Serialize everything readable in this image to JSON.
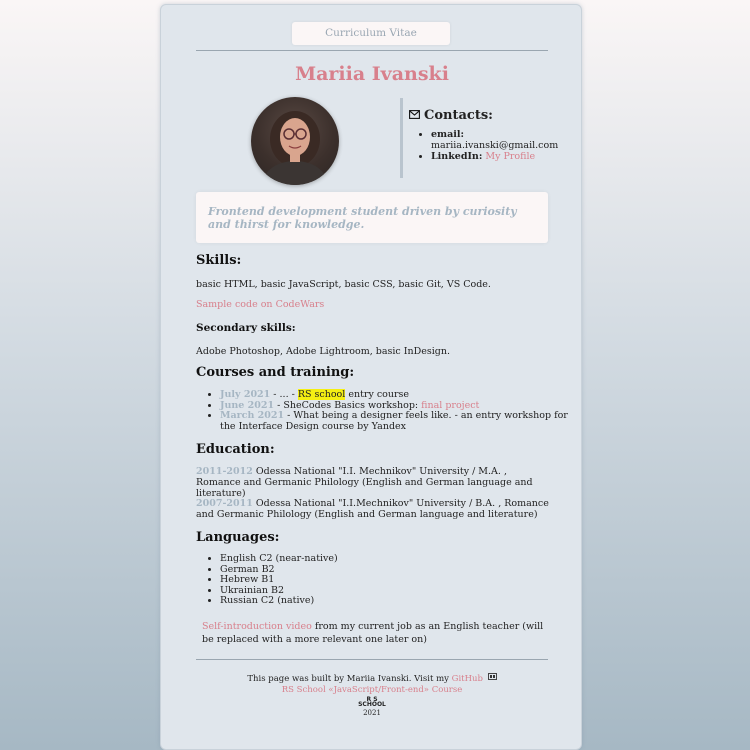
{
  "header": {
    "tag": "Curriculum Vitae",
    "name": "Mariia Ivanski"
  },
  "avatar": {
    "alt": "profile photo"
  },
  "contacts": {
    "title": "Contacts:",
    "email_label": "email:",
    "email_value": "mariia.ivanski@gmail.com",
    "linkedin_label": "LinkedIn:",
    "linkedin_link": "My Profile"
  },
  "about": {
    "text": "Frontend development student driven by curiosity and thirst for knowledge."
  },
  "skills": {
    "title": "Skills:",
    "text": "basic HTML, basic JavaScript, basic CSS, basic Git, VS Code.",
    "sample_link": "Sample code on CodeWars",
    "secondary_title": "Secondary skills:",
    "secondary_text": "Adobe Photoshop, Adobe Lightroom, basic InDesign."
  },
  "courses": {
    "title": "Courses and training:",
    "items": [
      {
        "date": "July 2021",
        "pre": " - ... - ",
        "highlight": "RS school",
        "post": " entry course"
      },
      {
        "date": "June 2021",
        "pre": " - SheCodes Basics workshop: ",
        "link": "final project"
      },
      {
        "date": "March 2021",
        "pre": " - What being a designer feels like. - an entry workshop for the Interface Design course by Yandex"
      }
    ]
  },
  "education": {
    "title": "Education:",
    "items": [
      {
        "years": "2011-2012",
        "text": " Odessa National \"I.I. Mechnikov\" University / M.A. , Romance and Germanic Philology (English and German language and literature)"
      },
      {
        "years": "2007-2011",
        "text": " Odessa National \"I.I.Mechnikov\" University / B.A. , Romance and Germanic Philology (English and German language and literature)"
      }
    ]
  },
  "languages": {
    "title": "Languages:",
    "items": [
      "English C2 (near-native)",
      "German B2",
      "Hebrew B1",
      "Ukrainian B2",
      "Russian C2 (native)"
    ]
  },
  "intro": {
    "link": "Self-introduction video",
    "text": " from my current job as an English teacher (will be replaced with a more relevant one later on)"
  },
  "footer": {
    "built_by": "This page was built by Mariia Ivanski. Visit my ",
    "github_link": "GitHub",
    "course_link": "RS School «JavaScript/Front-end» Course",
    "year": "2021",
    "rs_logo_text_1": "R S",
    "rs_logo_text_2": "SCHOOL"
  }
}
